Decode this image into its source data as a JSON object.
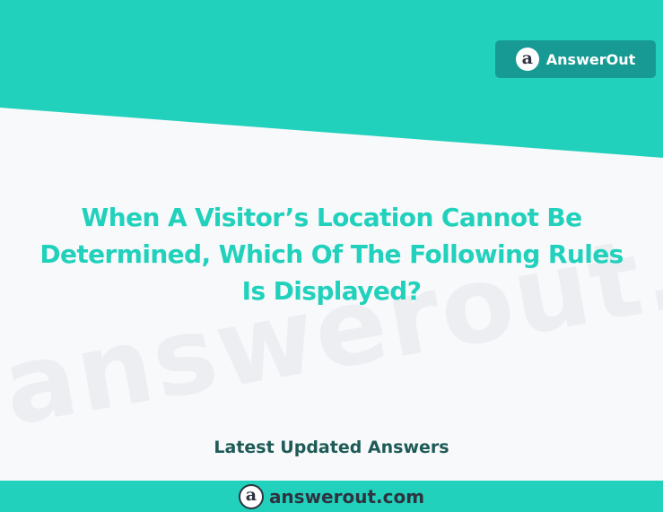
{
  "brand": {
    "badge_label": "AnswerOut",
    "logo_letter": "a",
    "logo_icon": "answerout-logo-icon",
    "watermark": "answerout.com",
    "accent_color": "#21d1bc",
    "badge_color": "#179a94"
  },
  "question": {
    "lines": [
      "When A Visitor’s Location Cannot Be",
      "Determined, Which Of The Following Rules",
      "Is Displayed?"
    ]
  },
  "subtitle": "Latest Updated Answers",
  "footer": {
    "site": "answerout.com"
  }
}
